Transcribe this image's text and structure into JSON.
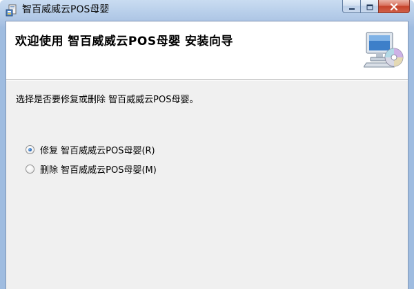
{
  "window": {
    "title": "智百威威云POS母婴"
  },
  "header": {
    "title": "欢迎使用 智百威威云POS母婴 安装向导"
  },
  "main": {
    "prompt": "选择是否要修复或删除 智百威威云POS母婴。",
    "options": [
      {
        "label": "修复 智百威威云POS母婴(R)",
        "selected": true
      },
      {
        "label": "删除 智百威威云POS母婴(M)",
        "selected": false
      }
    ]
  },
  "icons": {
    "title_icon": "installer-icon",
    "header_graphic": "computer-disc-icon",
    "minimize": "minimize-icon",
    "maximize": "maximize-icon",
    "close": "close-icon"
  },
  "colors": {
    "title_bar": "#b6cde9",
    "close_button": "#c5432a",
    "content_background": "#f0f0f0",
    "radio_dot": "#2466b8"
  }
}
